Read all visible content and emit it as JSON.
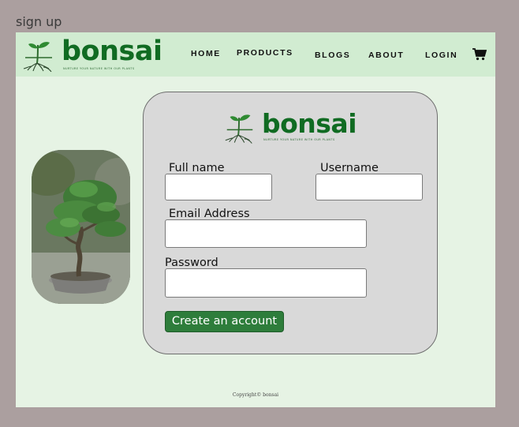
{
  "page_label": "sign up",
  "brand": {
    "name": "bonsai",
    "tagline": "NURTURE YOUR NATURE WITH OUR PLANTS",
    "color": "#106b22"
  },
  "nav": {
    "links": [
      "HOME",
      "PRODUCTS",
      "BLOGS",
      "ABOUT",
      "LOGIN"
    ],
    "cart_icon": "shopping-cart-icon"
  },
  "form": {
    "full_name_label": "Full name",
    "full_name_value": "",
    "username_label": "Username",
    "username_value": "",
    "email_label": "Email Address",
    "email_value": "",
    "password_label": "Password",
    "password_value": "",
    "submit_label": "Create an account",
    "button_color": "#2e7d3b"
  },
  "footer": {
    "text": "Copyright© bonsai"
  },
  "colors": {
    "outer_bg": "#ab9f9f",
    "page_bg": "#e6f3e4",
    "navbar_bg": "#d1ecd1",
    "card_bg": "#d9d9d9"
  }
}
